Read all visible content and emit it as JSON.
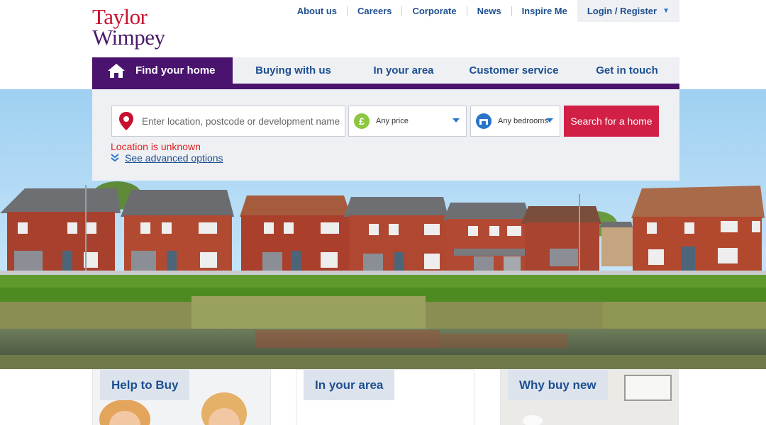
{
  "brand": {
    "line1": "Taylor",
    "line2": "Wimpey",
    "red": "#c8102e",
    "purple": "#4a1a6b"
  },
  "topnav": {
    "links": [
      "About us",
      "Careers",
      "Corporate",
      "News",
      "Inspire Me"
    ],
    "login": "Login / Register"
  },
  "mainnav": {
    "tabs": [
      "Find your home",
      "Buying with us",
      "In your area",
      "Customer service",
      "Get in touch"
    ],
    "active_color": "#4a146e"
  },
  "search": {
    "location_placeholder": "Enter location, postcode or development name",
    "price": "Any price",
    "bedrooms": "Any bedrooms",
    "button": "Search for a home",
    "error": "Location is unknown",
    "advanced": "See advanced options",
    "button_color": "#d21f45"
  },
  "cards": [
    "Help to Buy",
    "In your area",
    "Why buy new"
  ],
  "icons": {
    "home": "house-icon",
    "location": "map-pin-icon",
    "price": "pound-icon",
    "bedrooms": "bed-icon",
    "advanced": "double-chevron-down-icon"
  }
}
